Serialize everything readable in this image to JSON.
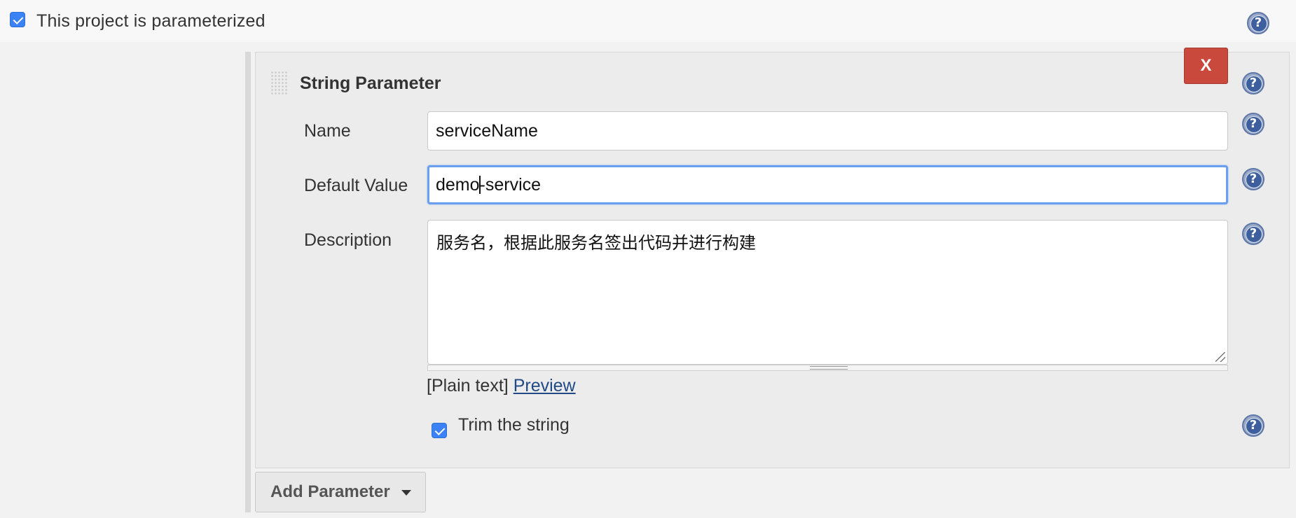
{
  "parameterized": {
    "label": "This project is parameterized",
    "checked": true
  },
  "parameter": {
    "type_title": "String Parameter",
    "delete_label": "X",
    "fields": {
      "name": {
        "label": "Name",
        "value": "serviceName"
      },
      "default_value": {
        "label": "Default Value",
        "value_before_caret": "demo",
        "value_after_caret": "-service"
      },
      "description": {
        "label": "Description",
        "value": "服务名，根据此服务名签出代码并进行构建"
      }
    },
    "markup": {
      "plain_text": "[Plain text]",
      "preview": "Preview"
    },
    "trim": {
      "label": "Trim the string",
      "checked": true
    },
    "help_glyph": "?"
  },
  "add_parameter": {
    "label": "Add Parameter"
  },
  "colors": {
    "accent_blue": "#3b82f6",
    "delete_red": "#c94a3c",
    "link": "#204a87",
    "help_icon": "#3e5f9e"
  }
}
